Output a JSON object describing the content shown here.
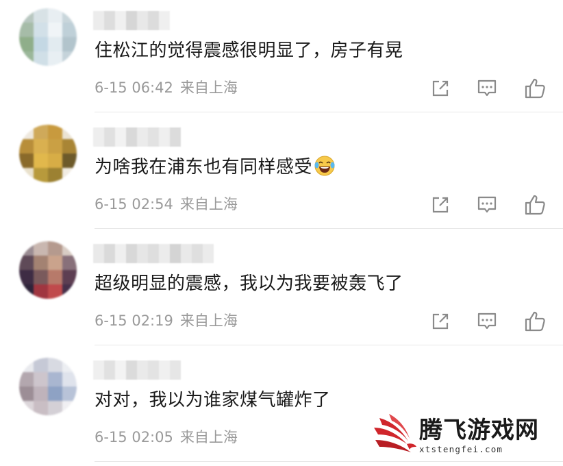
{
  "comments": [
    {
      "text": "住松江的觉得震感很明显了，房子有晃",
      "time": "6-15 06:42",
      "location": "来自上海",
      "has_emoji": false,
      "emoji": ""
    },
    {
      "text": "为啥我在浦东也有同样感受",
      "time": "6-15 02:54",
      "location": "来自上海",
      "has_emoji": true,
      "emoji": "laughing-with-tears"
    },
    {
      "text": "超级明显的震感，我以为我要被轰飞了",
      "time": "6-15 02:19",
      "location": "来自上海",
      "has_emoji": false,
      "emoji": ""
    },
    {
      "text": "对对，我以为谁家煤气罐炸了",
      "time": "6-15 02:05",
      "location": "来自上海",
      "has_emoji": false,
      "emoji": ""
    }
  ],
  "actions": {
    "share_icon": "share-icon",
    "comment_icon": "comment-icon",
    "like_icon": "thumbs-up-icon"
  },
  "watermark": {
    "title": "腾飞游戏网",
    "url": "xtstengfei.com",
    "logo_icon": "red-swoosh-logo"
  },
  "colors": {
    "text": "#1a1a1a",
    "meta": "#9a9a9a",
    "icon": "#8a8a8a",
    "divider": "#e6e6e6",
    "logo_red": "#d0262c"
  }
}
